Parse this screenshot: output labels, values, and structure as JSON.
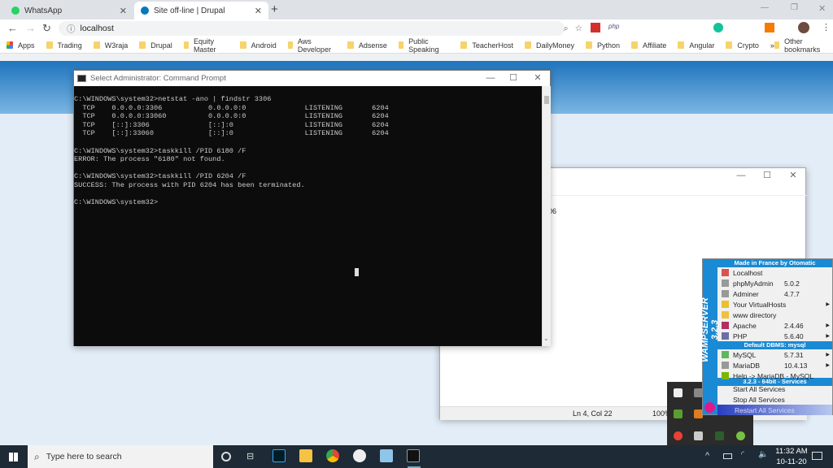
{
  "browser": {
    "tabs": [
      {
        "label": "WhatsApp",
        "active": false
      },
      {
        "label": "Site off-line | Drupal",
        "active": true
      }
    ],
    "new_tab": "+",
    "url": "localhost",
    "bookmarks": [
      "Apps",
      "Trading",
      "W3raja",
      "Drupal",
      "Equity Master",
      "Android",
      "Aws Developer",
      "Adsense",
      "Public Speaking",
      "TeacherHost",
      "DailyMoney",
      "Python",
      "Affiliate",
      "Angular",
      "Crypto"
    ],
    "more": "»",
    "other_bookmarks": "Other bookmarks"
  },
  "cmd": {
    "title": "Select Administrator: Command Prompt",
    "lines": [
      "C:\\WINDOWS\\system32>netstat -ano | findstr 3306",
      "  TCP    0.0.0.0:3306           0.0.0.0:0              LISTENING       6204",
      "  TCP    0.0.0.0:33060          0.0.0.0:0              LISTENING       6204",
      "  TCP    [::]:3306              [::]:0                 LISTENING       6204",
      "  TCP    [::]:33060             [::]:0                 LISTENING       6204",
      "",
      "C:\\WINDOWS\\system32>taskkill /PID 6180 /F",
      "ERROR: The process \"6180\" not found.",
      "",
      "C:\\WINDOWS\\system32>taskkill /PID 6204 /F",
      "SUCCESS: The process with PID 6204 has been terminated.",
      "",
      "C:\\WINDOWS\\system32>"
    ]
  },
  "notepad": {
    "partial_text": "06",
    "status_pos": "Ln 4, Col 22",
    "zoom": "100%"
  },
  "wamp": {
    "side_title": "WAMPSERVER 3.2.3",
    "header1": "Made in France by Otomatic",
    "items1": [
      {
        "label": "Localhost",
        "version": "",
        "arrow": false,
        "icon": "home-icon",
        "color": "#d9534f"
      },
      {
        "label": "phpMyAdmin",
        "version": "5.0.2",
        "arrow": false,
        "icon": "database-icon",
        "color": "#999999"
      },
      {
        "label": "Adminer",
        "version": "4.7.7",
        "arrow": false,
        "icon": "database-icon",
        "color": "#999999"
      },
      {
        "label": "Your VirtualHosts",
        "version": "",
        "arrow": true,
        "icon": "folder-icon",
        "color": "#e8c030"
      },
      {
        "label": "www directory",
        "version": "",
        "arrow": false,
        "icon": "folder-icon",
        "color": "#f0c040"
      },
      {
        "label": "Apache",
        "version": "2.4.46",
        "arrow": true,
        "icon": "feather-icon",
        "color": "#b03060"
      },
      {
        "label": "PHP",
        "version": "5.6.40",
        "arrow": true,
        "icon": "php-icon",
        "color": "#6a6fa8"
      }
    ],
    "header2": "Default DBMS: mysql",
    "items2": [
      {
        "label": "MySQL",
        "version": "5.7.31",
        "arrow": true,
        "icon": "check-icon",
        "color": "#5cb85c"
      },
      {
        "label": "MariaDB",
        "version": "10.4.13",
        "arrow": true,
        "icon": "database-icon",
        "color": "#999999"
      },
      {
        "label": "Help -> MariaDB - MySQL",
        "version": "",
        "arrow": false,
        "icon": "help-icon",
        "color": "#7ab800"
      }
    ],
    "header3": "3.2.3 - 64bit - Services",
    "services": [
      "Start All Services",
      "Stop All Services",
      "Restart All Services"
    ]
  },
  "taskbar": {
    "search_placeholder": "Type here to search",
    "time": "11:32 AM",
    "date": "10-11-20"
  }
}
